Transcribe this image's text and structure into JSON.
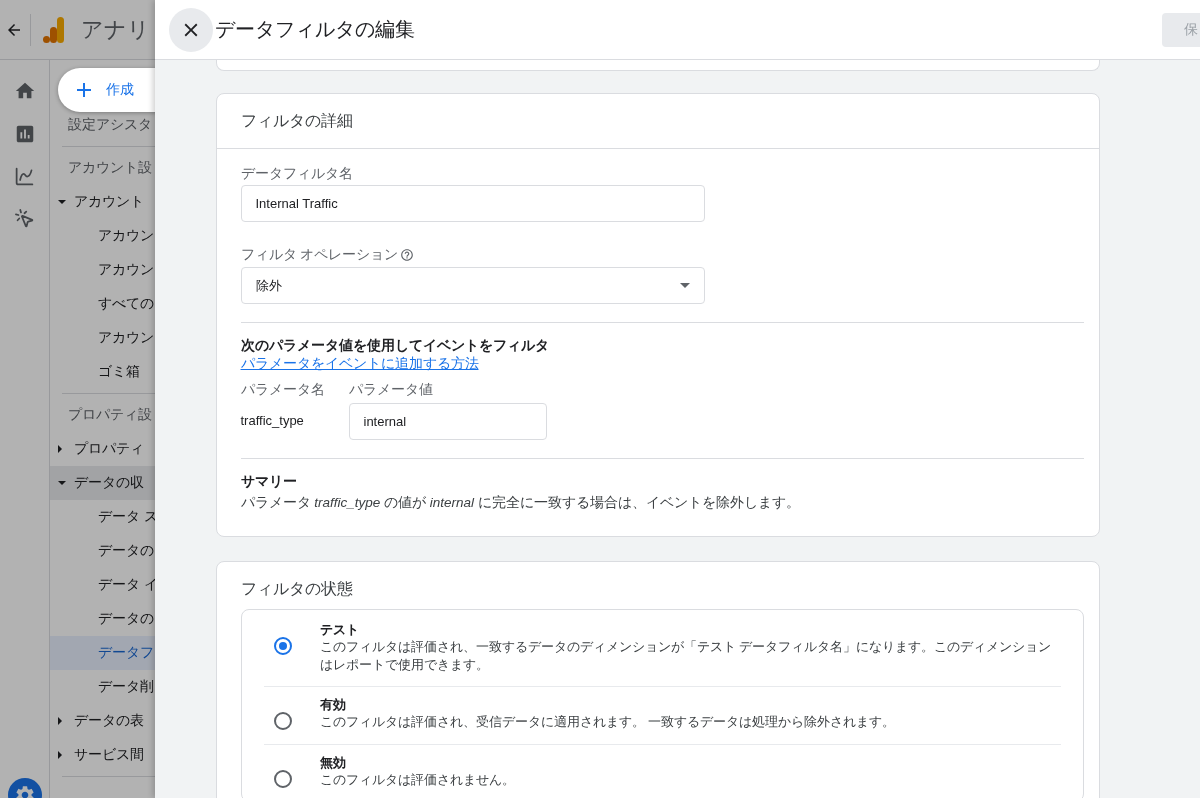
{
  "app_header": {
    "title": "アナリ"
  },
  "create_button": {
    "label": "作成"
  },
  "nav": [
    {
      "kind": "item",
      "label": "設定アシスタ"
    },
    {
      "kind": "section",
      "label": "アカウント設"
    },
    {
      "kind": "group",
      "label": "アカウント",
      "expanded": true,
      "highlighted": false,
      "children": [
        {
          "label": "アカウン",
          "selected": false
        },
        {
          "label": "アカウン",
          "selected": false
        },
        {
          "label": "すべての",
          "selected": false
        },
        {
          "label": "アカウン",
          "selected": false
        },
        {
          "label": "ゴミ箱",
          "selected": false
        }
      ]
    },
    {
      "kind": "section",
      "label": "プロパティ設"
    },
    {
      "kind": "group",
      "label": "プロパティ",
      "expanded": false,
      "highlighted": false
    },
    {
      "kind": "group",
      "label": "データの収",
      "expanded": true,
      "highlighted": true,
      "children": [
        {
          "label": "データ ス",
          "selected": false
        },
        {
          "label": "データの",
          "selected": false
        },
        {
          "label": "データ イ",
          "selected": false
        },
        {
          "label": "データの",
          "selected": false
        },
        {
          "label": "データフ",
          "selected": true
        },
        {
          "label": "データ削",
          "selected": false
        }
      ]
    },
    {
      "kind": "group",
      "label": "データの表",
      "expanded": false,
      "highlighted": false
    },
    {
      "kind": "group",
      "label": "サービス間",
      "expanded": false,
      "highlighted": false
    }
  ],
  "dialog": {
    "title": "データフィルタの編集",
    "save_button": {
      "label": "保",
      "disabled": true
    }
  },
  "details_card": {
    "title": "フィルタの詳細",
    "name_field": {
      "label": "データフィルタ名",
      "value": "Internal Traffic"
    },
    "operation_field": {
      "label": "フィルタ オペレーション",
      "value": "除外"
    },
    "parameter_section": {
      "heading": "次のパラメータ値を使用してイベントをフィルタ",
      "link": "パラメータをイベントに追加する方法",
      "name_label": "パラメータ名",
      "value_label": "パラメータ値",
      "name": "traffic_type",
      "value": "internal"
    },
    "summary": {
      "heading": "サマリー",
      "text": "パラメータ *traffic_type* の値が *internal* に完全に一致する場合は、イベントを除外します。"
    }
  },
  "state_card": {
    "title": "フィルタの状態",
    "options": [
      {
        "label": "テスト",
        "description": "このフィルタは評価され、一致するデータのディメンションが「テスト データフィルタ名」になります。このディメンションはレポートで使用できます。",
        "selected": true
      },
      {
        "label": "有効",
        "description": "このフィルタは評価され、受信データに適用されます。 一致するデータは処理から除外されます。",
        "selected": false
      },
      {
        "label": "無効",
        "description": "このフィルタは評価されません。",
        "selected": false
      }
    ]
  }
}
